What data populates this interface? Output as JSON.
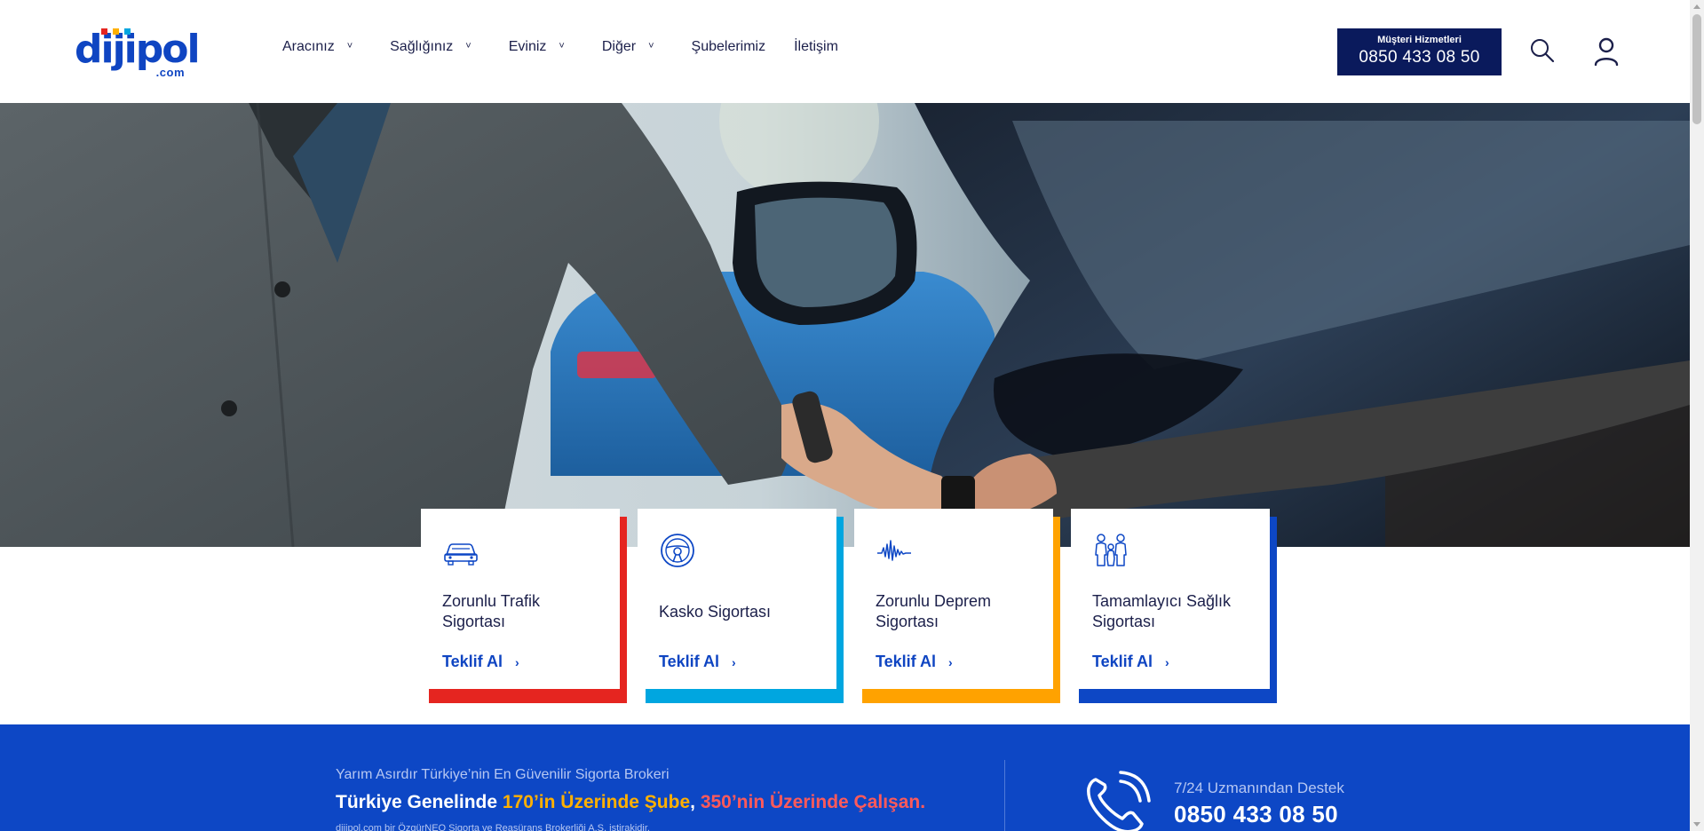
{
  "brand": {
    "logo_text": "dijipol",
    "logo_suffix": ".com",
    "logo_dot_colors": [
      "#e52520",
      "#ffb000",
      "#00a6e0"
    ]
  },
  "nav": {
    "items": [
      {
        "label": "Aracınız",
        "has_dropdown": true
      },
      {
        "label": "Sağlığınız",
        "has_dropdown": true
      },
      {
        "label": "Eviniz",
        "has_dropdown": true
      },
      {
        "label": "Diğer",
        "has_dropdown": true
      },
      {
        "label": "Şubelerimiz",
        "has_dropdown": false
      },
      {
        "label": "İletişim",
        "has_dropdown": false
      }
    ],
    "dropdown_glyph": "˅"
  },
  "customer_service": {
    "title": "Müşteri Hizmetleri",
    "phone": "0850 433 08 50"
  },
  "icons": {
    "search": "search-icon",
    "account": "user-icon"
  },
  "cards": [
    {
      "title": "Zorunlu Trafik Sigortası",
      "cta": "Teklif Al",
      "icon": "car-icon",
      "accent": "#e52520"
    },
    {
      "title": "Kasko Sigortası",
      "cta": "Teklif Al",
      "icon": "steering-wheel-icon",
      "accent": "#00a6e0"
    },
    {
      "title": "Zorunlu Deprem Sigortası",
      "cta": "Teklif Al",
      "icon": "seismograph-icon",
      "accent": "#ffa200"
    },
    {
      "title": "Tamamlayıcı Sağlık Sigortası",
      "cta": "Teklif Al",
      "icon": "family-icon",
      "accent": "#0d47c5"
    }
  ],
  "band": {
    "tagline": "Yarım Asırdır Türkiye’nin En Güvenilir Sigorta Brokeri",
    "headline_prefix": "Türkiye Genelinde ",
    "headline_branches": "170’in Üzerinde Şube",
    "headline_sep": ", ",
    "headline_staff": "350’nin Üzerinde Çalışan.",
    "footnote": "dijipol.com bir ÖzgürNEO Sigorta ve Reasürans Brokerliği A.Ş. iştirakidir.",
    "support_label": "7/24 Uzmanından Destek",
    "support_phone": "0850 433 08 50"
  },
  "colors": {
    "brand_blue": "#0d47c5",
    "navy": "#0a1a5c",
    "orange": "#ffb000",
    "red": "#e52520"
  }
}
